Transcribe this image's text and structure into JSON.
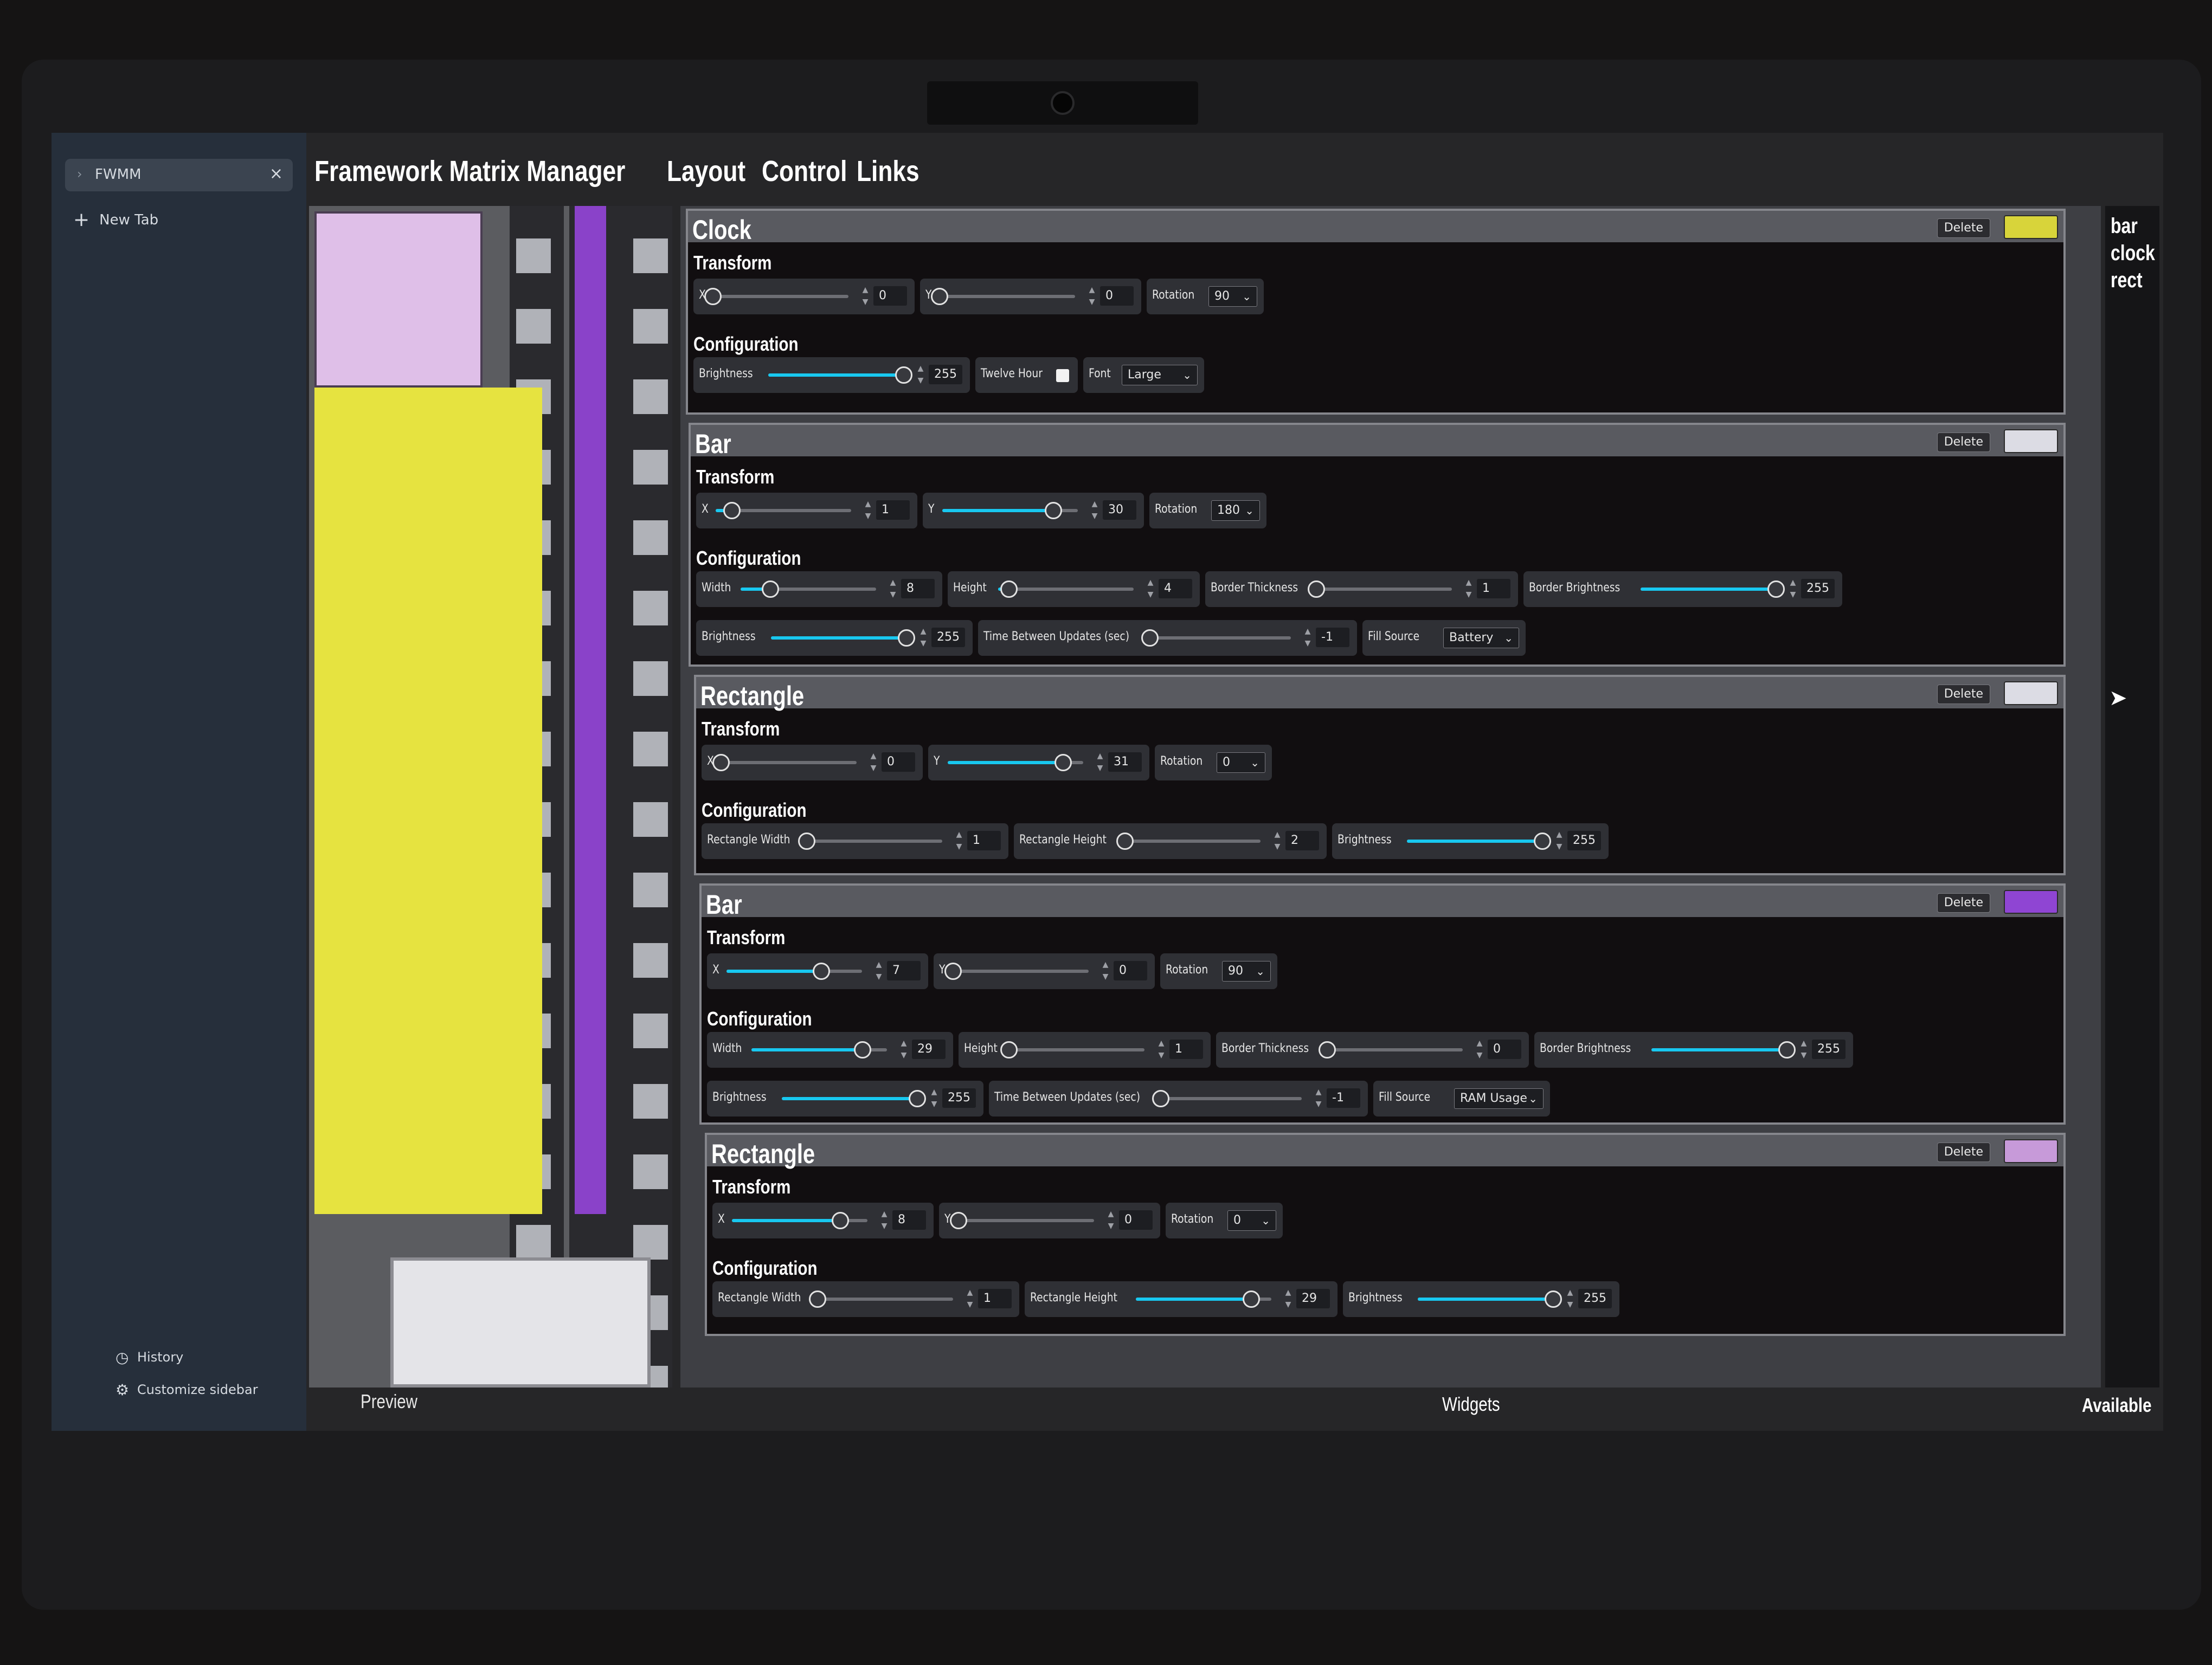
{
  "browser": {
    "tab_label": "FWMM",
    "tab_close": "×",
    "new_tab": "New Tab",
    "history": "History",
    "customize": "Customize sidebar"
  },
  "app": {
    "title": "Framework Matrix Manager",
    "nav": [
      "Layout",
      "Control",
      "Links"
    ]
  },
  "panels": {
    "preview": "Preview",
    "widgets": "Widgets",
    "available": "Available",
    "available_items": [
      "bar",
      "clock",
      "rect"
    ]
  },
  "labels": {
    "delete": "Delete",
    "transform": "Transform",
    "configuration": "Configuration"
  },
  "colors": {
    "accent": "#18c8f0",
    "preview_yellow": "#e6e340",
    "preview_purple": "#8a42c9",
    "preview_pink": "#dfbfe8",
    "preview_white": "#e4e4e8"
  },
  "widgets": [
    {
      "title": "Clock",
      "color": "#d8d43a",
      "x": {
        "label": "X",
        "value": "0",
        "fraction": 0
      },
      "y": {
        "label": "Y",
        "value": "0",
        "fraction": 0
      },
      "rotation": {
        "label": "Rotation",
        "value": "90"
      },
      "config": [
        {
          "kind": "slider",
          "label": "Brightness",
          "value": "255",
          "fraction": 1.0
        },
        {
          "kind": "check",
          "label": "Twelve Hour"
        },
        {
          "kind": "select",
          "label": "Font",
          "value": "Large"
        }
      ]
    },
    {
      "title": "Bar",
      "color": "#dcdce4",
      "x": {
        "label": "X",
        "value": "1",
        "fraction": 0.12
      },
      "y": {
        "label": "Y",
        "value": "30",
        "fraction": 0.82
      },
      "rotation": {
        "label": "Rotation",
        "value": "180"
      },
      "config": [
        {
          "kind": "slider",
          "label": "Width",
          "value": "8",
          "fraction": 0.22
        },
        {
          "kind": "slider",
          "label": "Height",
          "value": "4",
          "fraction": 0.08
        },
        {
          "kind": "slider",
          "label": "Border Thickness",
          "value": "1",
          "fraction": 0
        },
        {
          "kind": "slider",
          "label": "Border Brightness",
          "value": "255",
          "fraction": 1.0
        },
        {
          "kind": "slider",
          "label": "Brightness",
          "value": "255",
          "fraction": 1.0
        },
        {
          "kind": "slider",
          "label": "Time Between Updates (sec)",
          "value": "-1",
          "fraction": 0
        },
        {
          "kind": "select",
          "label": "Fill Source",
          "value": "Battery"
        }
      ]
    },
    {
      "title": "Rectangle",
      "color": "#dcdce4",
      "x": {
        "label": "X",
        "value": "0",
        "fraction": 0
      },
      "y": {
        "label": "Y",
        "value": "31",
        "fraction": 0.85
      },
      "rotation": {
        "label": "Rotation",
        "value": "0"
      },
      "config": [
        {
          "kind": "slider",
          "label": "Rectangle Width",
          "value": "1",
          "fraction": 0
        },
        {
          "kind": "slider",
          "label": "Rectangle Height",
          "value": "2",
          "fraction": 0
        },
        {
          "kind": "slider",
          "label": "Brightness",
          "value": "255",
          "fraction": 1.0
        }
      ]
    },
    {
      "title": "Bar",
      "color": "#8f45d3",
      "x": {
        "label": "X",
        "value": "7",
        "fraction": 0.7
      },
      "y": {
        "label": "Y",
        "value": "0",
        "fraction": 0
      },
      "rotation": {
        "label": "Rotation",
        "value": "90"
      },
      "config": [
        {
          "kind": "slider",
          "label": "Width",
          "value": "29",
          "fraction": 0.82
        },
        {
          "kind": "slider",
          "label": "Height",
          "value": "1",
          "fraction": 0
        },
        {
          "kind": "slider",
          "label": "Border Thickness",
          "value": "0",
          "fraction": 0
        },
        {
          "kind": "slider",
          "label": "Border Brightness",
          "value": "255",
          "fraction": 1.0
        },
        {
          "kind": "slider",
          "label": "Brightness",
          "value": "255",
          "fraction": 1.0
        },
        {
          "kind": "slider",
          "label": "Time Between Updates (sec)",
          "value": "-1",
          "fraction": 0
        },
        {
          "kind": "select",
          "label": "Fill Source",
          "value": "RAM Usage"
        }
      ]
    },
    {
      "title": "Rectangle",
      "color": "#c79ad9",
      "x": {
        "label": "X",
        "value": "8",
        "fraction": 0.8
      },
      "y": {
        "label": "Y",
        "value": "0",
        "fraction": 0
      },
      "rotation": {
        "label": "Rotation",
        "value": "0"
      },
      "config": [
        {
          "kind": "slider",
          "label": "Rectangle Width",
          "value": "1",
          "fraction": 0
        },
        {
          "kind": "slider",
          "label": "Rectangle Height",
          "value": "29",
          "fraction": 0.85
        },
        {
          "kind": "slider",
          "label": "Brightness",
          "value": "255",
          "fraction": 1.0
        }
      ]
    }
  ]
}
